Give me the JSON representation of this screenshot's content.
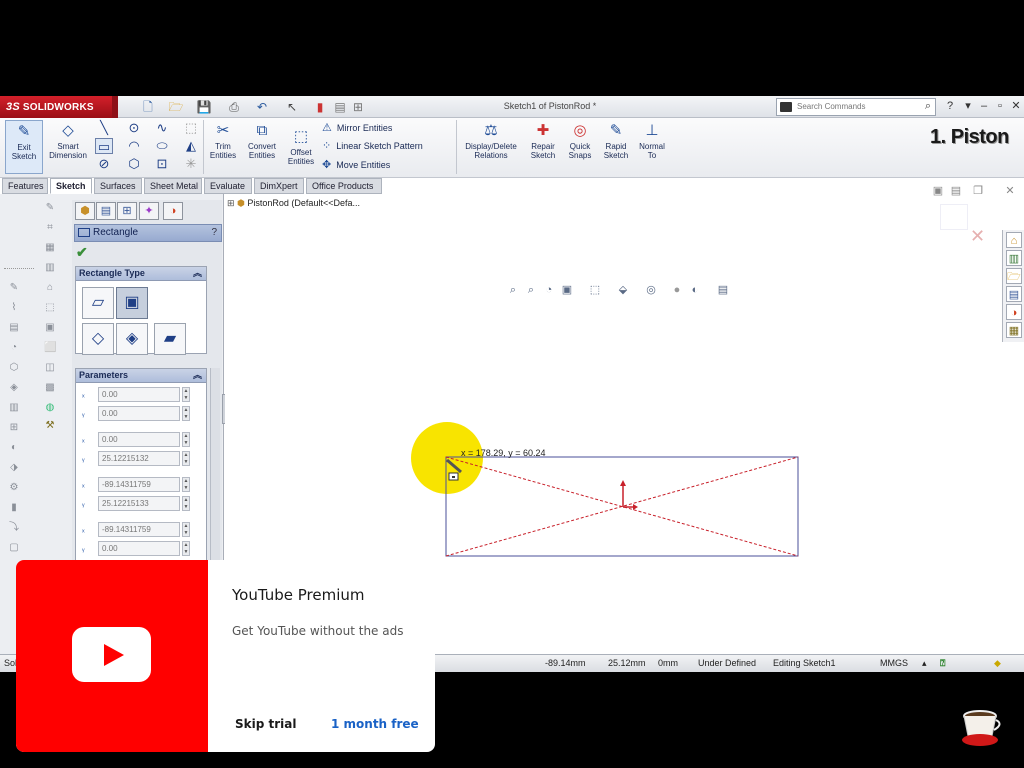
{
  "app": {
    "brand_prefix": "3S",
    "brand": "SOLIDWORKS",
    "doc_title": "Sketch1 of PistonRod *",
    "search_placeholder": "Search Commands"
  },
  "commands": {
    "exit_sketch": [
      "Exit",
      "Sketch"
    ],
    "smart_dimension": [
      "Smart",
      "Dimension"
    ],
    "trim": [
      "Trim",
      "Entities"
    ],
    "convert": [
      "Convert",
      "Entities"
    ],
    "offset": [
      "Offset",
      "Entities"
    ],
    "mirror": "Mirror Entities",
    "linear_pattern": "Linear Sketch Pattern",
    "move": "Move Entities",
    "display_delete": [
      "Display/Delete",
      "Relations"
    ],
    "repair": [
      "Repair",
      "Sketch"
    ],
    "quick_snaps": [
      "Quick",
      "Snaps"
    ],
    "rapid_sketch": [
      "Rapid",
      "Sketch"
    ],
    "normal_to": [
      "Normal",
      "To"
    ]
  },
  "overlay_label": "1. Piston",
  "tabs": [
    "Features",
    "Sketch",
    "Surfaces",
    "Sheet Metal",
    "Evaluate",
    "DimXpert",
    "Office Products"
  ],
  "property_manager": {
    "title": "Rectangle",
    "help": "?",
    "rect_type_header": "Rectangle Type",
    "params_header": "Parameters",
    "fields": [
      "0.00",
      "0.00",
      "0.00",
      "25.12215132",
      "-89.14311759",
      "25.12215133",
      "-89.14311759",
      "0.00"
    ]
  },
  "tree_root": "PistonRod  (Default<<Defa...",
  "canvas": {
    "coord_readout": "x = 178.29, y = 60.24"
  },
  "status": {
    "prefix": "Sol",
    "x": "-89.14mm",
    "y": "25.12mm",
    "z": "0mm",
    "state": "Under Defined",
    "editing": "Editing Sketch1",
    "units": "MMGS"
  },
  "ad": {
    "title": "YouTube Premium",
    "subtitle": "Get YouTube without the ads",
    "skip": "Skip trial",
    "offer": "1 month free"
  },
  "colors": {
    "brand_red": "#d3202a",
    "youtube_red": "#ff0000",
    "sketch_line": "#4a4f9a",
    "construction": "#c8202a",
    "highlight": "#f8e400"
  }
}
